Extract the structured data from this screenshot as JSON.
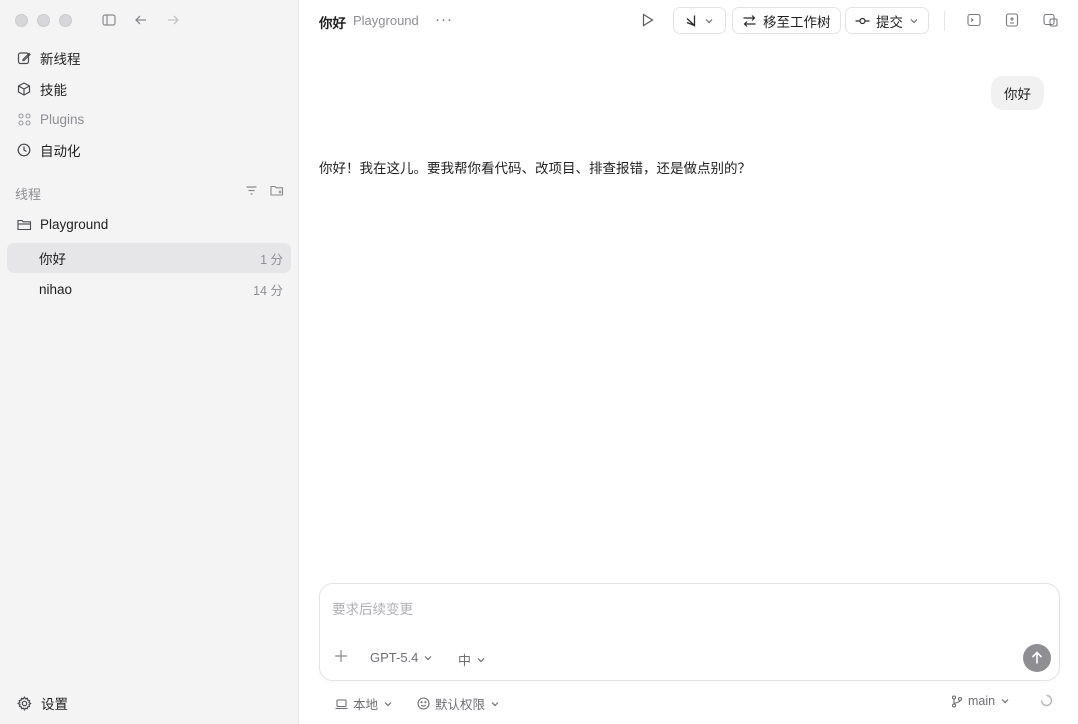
{
  "sidebar": {
    "nav": [
      {
        "label": "新线程",
        "icon": "edit-icon"
      },
      {
        "label": "技能",
        "icon": "cube-icon"
      },
      {
        "label": "Plugins",
        "icon": "grid-icon"
      },
      {
        "label": "自动化",
        "icon": "clock-icon"
      }
    ],
    "section_label": "线程",
    "project": "Playground",
    "threads": [
      {
        "title": "你好",
        "time": "1 分",
        "active": true
      },
      {
        "title": "nihao",
        "time": "14 分",
        "active": false
      }
    ],
    "settings_label": "设置"
  },
  "header": {
    "title": "你好",
    "subtitle": "Playground",
    "more": "···",
    "worktree_label": "移至工作树",
    "commit_label": "提交"
  },
  "chat": {
    "user_message": "你好",
    "assistant_message": "你好！我在这儿。要我帮你看代码、改项目、排查报错，还是做点别的？"
  },
  "composer": {
    "placeholder": "要求后续变更",
    "model": "GPT-5.4",
    "effort": "中"
  },
  "footer": {
    "location": "本地",
    "permissions": "默认权限",
    "branch": "main"
  },
  "colors": {
    "sidebar_bg": "#f4f4f5",
    "active_thread_bg": "#e6e6e8",
    "send_button": "#8e8e93"
  }
}
